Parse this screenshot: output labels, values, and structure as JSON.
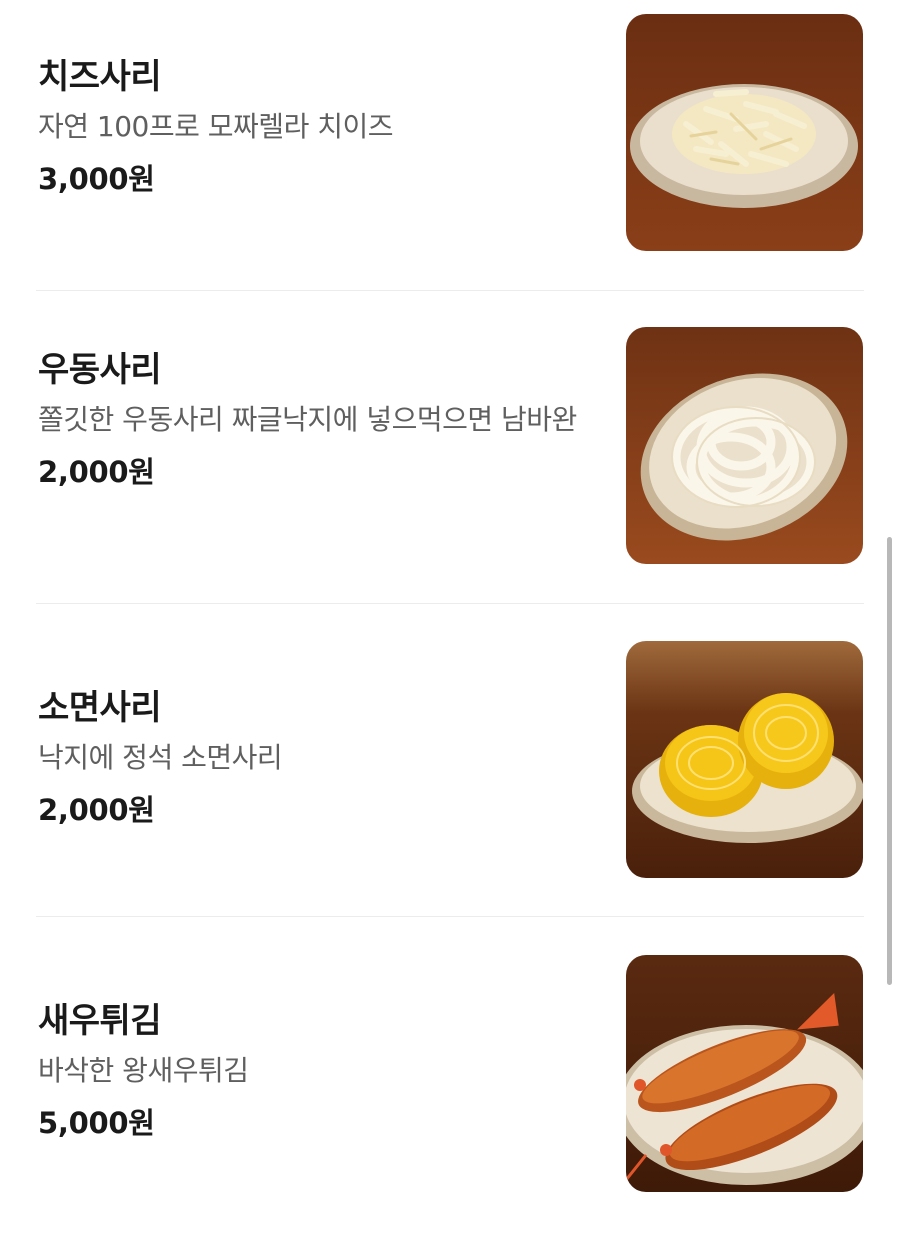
{
  "menu": {
    "items": [
      {
        "name": "치즈사리",
        "description": "자연 100프로 모짜렐라 치이즈",
        "price": "3,000원",
        "image_icon": "cheese-topping-photo"
      },
      {
        "name": "우동사리",
        "description": "쫄깃한 우동사리 짜글낙지에 넣으먹으면 남바완",
        "price": "2,000원",
        "image_icon": "udon-noodle-photo"
      },
      {
        "name": "소면사리",
        "description": "낙지에 정석 소면사리",
        "price": "2,000원",
        "image_icon": "somyeon-noodle-photo"
      },
      {
        "name": "새우튀김",
        "description": "바삭한 왕새우튀김",
        "price": "5,000원",
        "image_icon": "fried-shrimp-photo"
      }
    ]
  }
}
